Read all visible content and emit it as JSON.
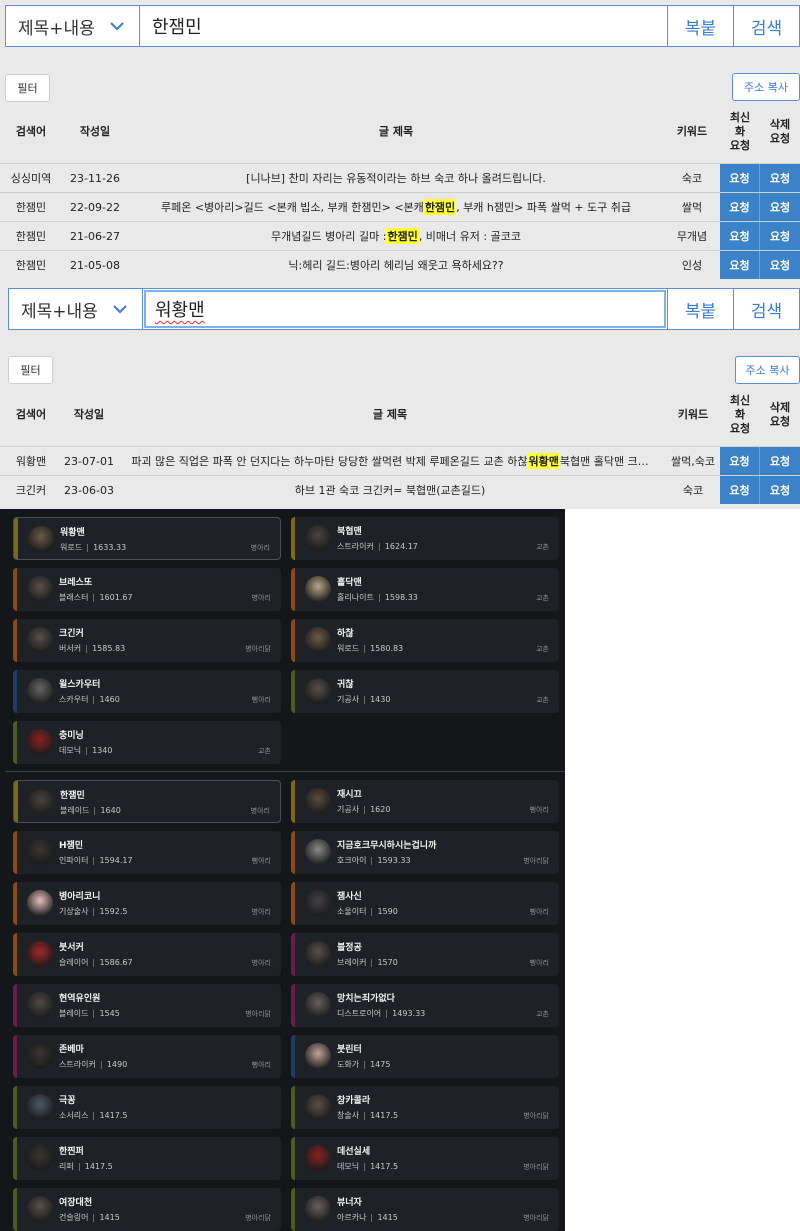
{
  "panel1": {
    "search": {
      "scope": "제목+내용",
      "query": "한잼민",
      "copy_label": "복붙",
      "search_label": "검색"
    },
    "filter_label": "필터",
    "addr_copy_label": "주소 복사",
    "headers": {
      "user": "검색어",
      "date": "작성일",
      "title": "글 제목",
      "keyword": "키워드",
      "recent": "최신\n화\n요청",
      "delete": "삭제\n요청"
    },
    "rows": [
      {
        "user": "싱싱미역",
        "date": "23-11-26",
        "title_pre": "[니나브] 찬미 자리는 유동적이라는 하브 숙코 하나 올려드립니다.",
        "title_hl": "",
        "title_post": "",
        "keyword": "숙코",
        "req1": "요청",
        "req2": "요청"
      },
      {
        "user": "한잼민",
        "date": "22-09-22",
        "title_pre": "루페온 <병아리>길드 <본캐 빕소, 부캐 한잼민> <본캐 ",
        "title_hl": "한잼민",
        "title_post": ", 부캐 h잼민> 파폭 쌀먹 + 도구 취급",
        "keyword": "쌀먹",
        "req1": "요청",
        "req2": "요청"
      },
      {
        "user": "한잼민",
        "date": "21-06-27",
        "title_pre": "무개념길드 병아리 길마 : ",
        "title_hl": "한잼민",
        "title_post": " , 비매너 유저 : 골코코",
        "keyword": "무개념",
        "req1": "요청",
        "req2": "요청"
      },
      {
        "user": "한잼민",
        "date": "21-05-08",
        "title_pre": "닉:헤리 길드:병아리 헤리님 왜웃고 욕하세요??",
        "title_hl": "",
        "title_post": "",
        "keyword": "인성",
        "req1": "요청",
        "req2": "요청"
      }
    ]
  },
  "panel2": {
    "search": {
      "scope": "제목+내용",
      "query": "워황맨",
      "copy_label": "복붙",
      "search_label": "검색"
    },
    "filter_label": "필터",
    "addr_copy_label": "주소 복사",
    "headers": {
      "user": "검색어",
      "date": "작성일",
      "title": "글 제목",
      "keyword": "키워드",
      "recent": "최신\n화\n요청",
      "delete": "삭제\n요청"
    },
    "rows": [
      {
        "user": "워황맨",
        "date": "23-07-01",
        "title_pre": "파괴 많은 직업은 파폭 안 던지다는 하누마탄 당당한 쌀먹련 박제 루페온길드 교촌 하찮 ",
        "title_hl": "워황맨",
        "title_post": " 북협맨 홀닥맨 크…",
        "keyword": "쌀먹,숙코",
        "req1": "요청",
        "req2": "요청"
      },
      {
        "user": "크긴커",
        "date": "23-06-03",
        "title_pre": "하브 1관 숙코 크긴커= 북협맨(교촌길드)",
        "title_hl": "",
        "title_post": "",
        "keyword": "숙코",
        "req1": "요청",
        "req2": "요청"
      }
    ]
  },
  "game": {
    "group1": [
      {
        "name": "워황맨",
        "cls": "워로드",
        "level": "1633.33",
        "guild": "병아리",
        "bar": "#7a6a1c",
        "avatar": "#6b5a48",
        "selected": true
      },
      {
        "name": "북협맨",
        "cls": "스트라이커",
        "level": "1624.17",
        "guild": "교촌",
        "bar": "#7a6a1c",
        "avatar": "#4a4440",
        "selected": false
      },
      {
        "name": "브레스또",
        "cls": "블래스터",
        "level": "1601.67",
        "guild": "병아리",
        "bar": "#8a4a16",
        "avatar": "#5a5048",
        "selected": false
      },
      {
        "name": "홀닥맨",
        "cls": "홀리나이트",
        "level": "1598.33",
        "guild": "교촌",
        "bar": "#8a4a16",
        "avatar": "#b8a888",
        "selected": false
      },
      {
        "name": "크긴커",
        "cls": "버서커",
        "level": "1585.83",
        "guild": "병아리닭",
        "bar": "#8a4a16",
        "avatar": "#55504a",
        "selected": false
      },
      {
        "name": "하찮",
        "cls": "워로드",
        "level": "1580.83",
        "guild": "교촌",
        "bar": "#8a4a16",
        "avatar": "#6b5a48",
        "selected": false
      },
      {
        "name": "윌스카우터",
        "cls": "스카우터",
        "level": "1460",
        "guild": "뻥아리",
        "bar": "#1c3f6a",
        "avatar": "#666666",
        "selected": false
      },
      {
        "name": "귀찮",
        "cls": "기공사",
        "level": "1430",
        "guild": "교촌",
        "bar": "#4c5a24",
        "avatar": "#55504a",
        "selected": false
      },
      {
        "name": "충미닝",
        "cls": "데모닉",
        "level": "1340",
        "guild": "교촌",
        "bar": "#4c5a24",
        "avatar": "#8a2222",
        "selected": false
      }
    ],
    "group2": [
      {
        "name": "한잼민",
        "cls": "블레이드",
        "level": "1640",
        "guild": "병아리",
        "bar": "#7a6a1c",
        "avatar": "#4a4440",
        "selected": true
      },
      {
        "name": "재시끄",
        "cls": "기공사",
        "level": "1620",
        "guild": "뻥아리",
        "bar": "#7a6a1c",
        "avatar": "#5a4a40",
        "selected": false
      },
      {
        "name": "H잼민",
        "cls": "인파이터",
        "level": "1594.17",
        "guild": "뻥아리",
        "bar": "#8a4a16",
        "avatar": "#3a3434",
        "selected": false
      },
      {
        "name": "지금호크무시하시는겁니까",
        "cls": "호크아이",
        "level": "1593.33",
        "guild": "병아리닭",
        "bar": "#8a4a16",
        "avatar": "#8a8a8a",
        "selected": false
      },
      {
        "name": "병아리코니",
        "cls": "기상술사",
        "level": "1592.5",
        "guild": "병아리",
        "bar": "#8a4a16",
        "avatar": "#e8c0c0",
        "selected": false
      },
      {
        "name": "잼사신",
        "cls": "소울이터",
        "level": "1590",
        "guild": "뻥아리",
        "bar": "#8a4a16",
        "avatar": "#44404a",
        "selected": false
      },
      {
        "name": "붓서커",
        "cls": "슬레이어",
        "level": "1586.67",
        "guild": "병아리",
        "bar": "#8a4a16",
        "avatar": "#a02828",
        "selected": false
      },
      {
        "name": "블정공",
        "cls": "브레이커",
        "level": "1570",
        "guild": "뻥아리",
        "bar": "#6a1c4a",
        "avatar": "#5a504a",
        "selected": false
      },
      {
        "name": "현역유인원",
        "cls": "블레이드",
        "level": "1545",
        "guild": "병아리닭",
        "bar": "#6a1c4a",
        "avatar": "#504848",
        "selected": false
      },
      {
        "name": "망치는죄가없다",
        "cls": "디스트로이어",
        "level": "1493.33",
        "guild": "교촌",
        "bar": "#6a1c4a",
        "avatar": "#666060",
        "selected": false
      },
      {
        "name": "존베마",
        "cls": "스트라이커",
        "level": "1490",
        "guild": "뻥아리",
        "bar": "#6a1c4a",
        "avatar": "#3a3434",
        "selected": false
      },
      {
        "name": "붓린터",
        "cls": "도화가",
        "level": "1475",
        "guild": "",
        "bar": "#1c3f6a",
        "avatar": "#c0a898",
        "selected": false
      },
      {
        "name": "극꽁",
        "cls": "소서리스",
        "level": "1417.5",
        "guild": "",
        "bar": "#4c5a24",
        "avatar": "#4a5a6a",
        "selected": false
      },
      {
        "name": "창카콜라",
        "cls": "창술사",
        "level": "1417.5",
        "guild": "병아리닭",
        "bar": "#4c5a24",
        "avatar": "#5a5048",
        "selected": false
      },
      {
        "name": "한찐퍼",
        "cls": "리퍼",
        "level": "1417.5",
        "guild": "",
        "bar": "#4c5a24",
        "avatar": "#3a3434",
        "selected": false
      },
      {
        "name": "데선실세",
        "cls": "데모닉",
        "level": "1417.5",
        "guild": "병아리닭",
        "bar": "#4c5a24",
        "avatar": "#8a2222",
        "selected": false
      },
      {
        "name": "여장대천",
        "cls": "건슬링어",
        "level": "1415",
        "guild": "병아리닭",
        "bar": "#4c5a24",
        "avatar": "#5a5048",
        "selected": false
      },
      {
        "name": "뷰너자",
        "cls": "아르카나",
        "level": "1415",
        "guild": "병아리닭",
        "bar": "#4c5a24",
        "avatar": "#6a6060",
        "selected": false
      }
    ]
  }
}
